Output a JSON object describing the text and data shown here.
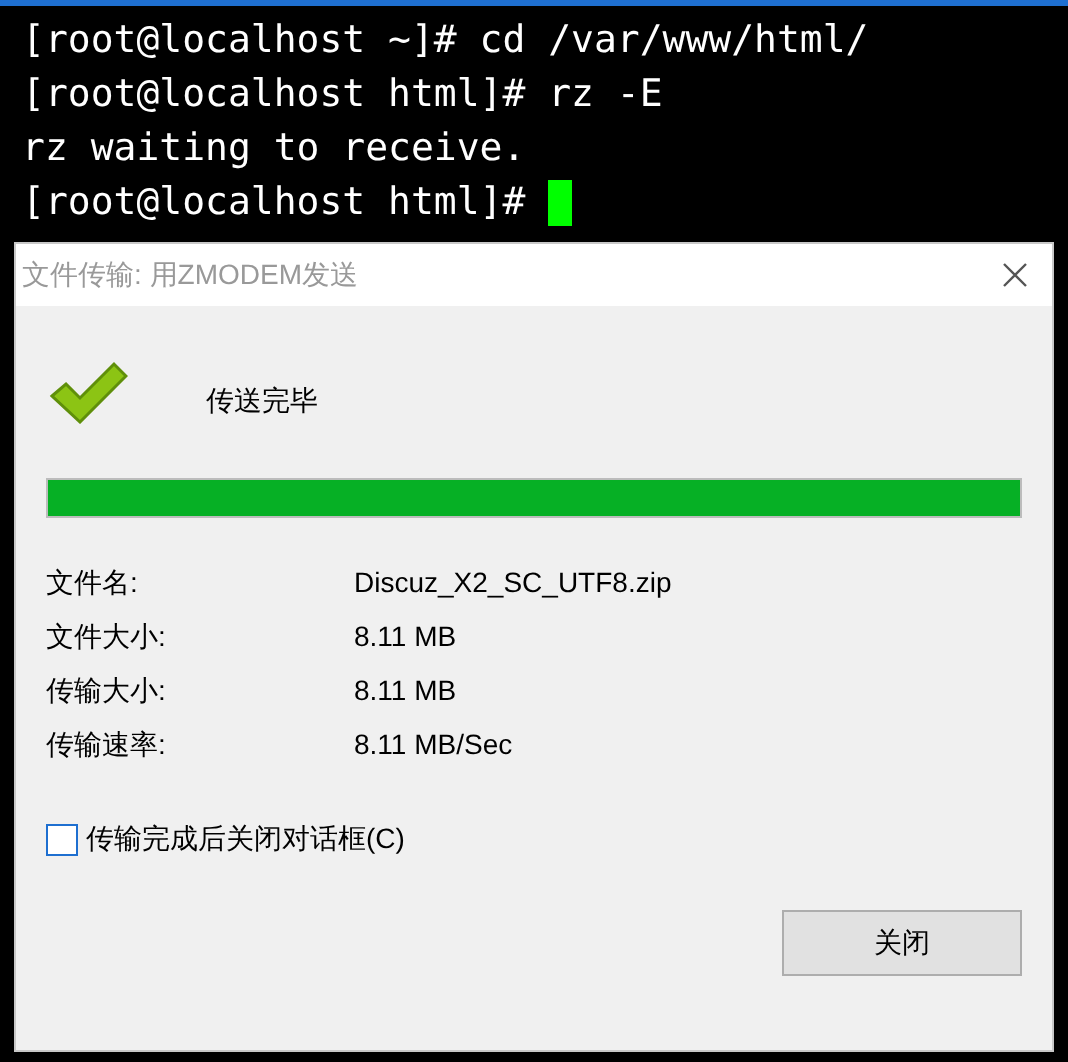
{
  "terminal": {
    "lines": [
      "[root@localhost ~]# cd /var/www/html/",
      "[root@localhost html]# rz -E",
      "rz waiting to receive.",
      "[root@localhost html]# "
    ],
    "cursor": true
  },
  "dialog": {
    "title": "文件传输: 用ZMODEM发送",
    "status": "传送完毕",
    "progress": {
      "level": 1
    },
    "fields": [
      {
        "label": "文件名:",
        "value": "Discuz_X2_SC_UTF8.zip"
      },
      {
        "label": "文件大小:",
        "value": "8.11 MB"
      },
      {
        "label": "传输大小:",
        "value": "8.11 MB"
      },
      {
        "label": "传输速率:",
        "value": "8.11 MB/Sec"
      }
    ],
    "close_when_done": {
      "label": "传输完成后关闭对话框(C)",
      "checked": false
    },
    "buttons": [
      "关闭"
    ]
  }
}
